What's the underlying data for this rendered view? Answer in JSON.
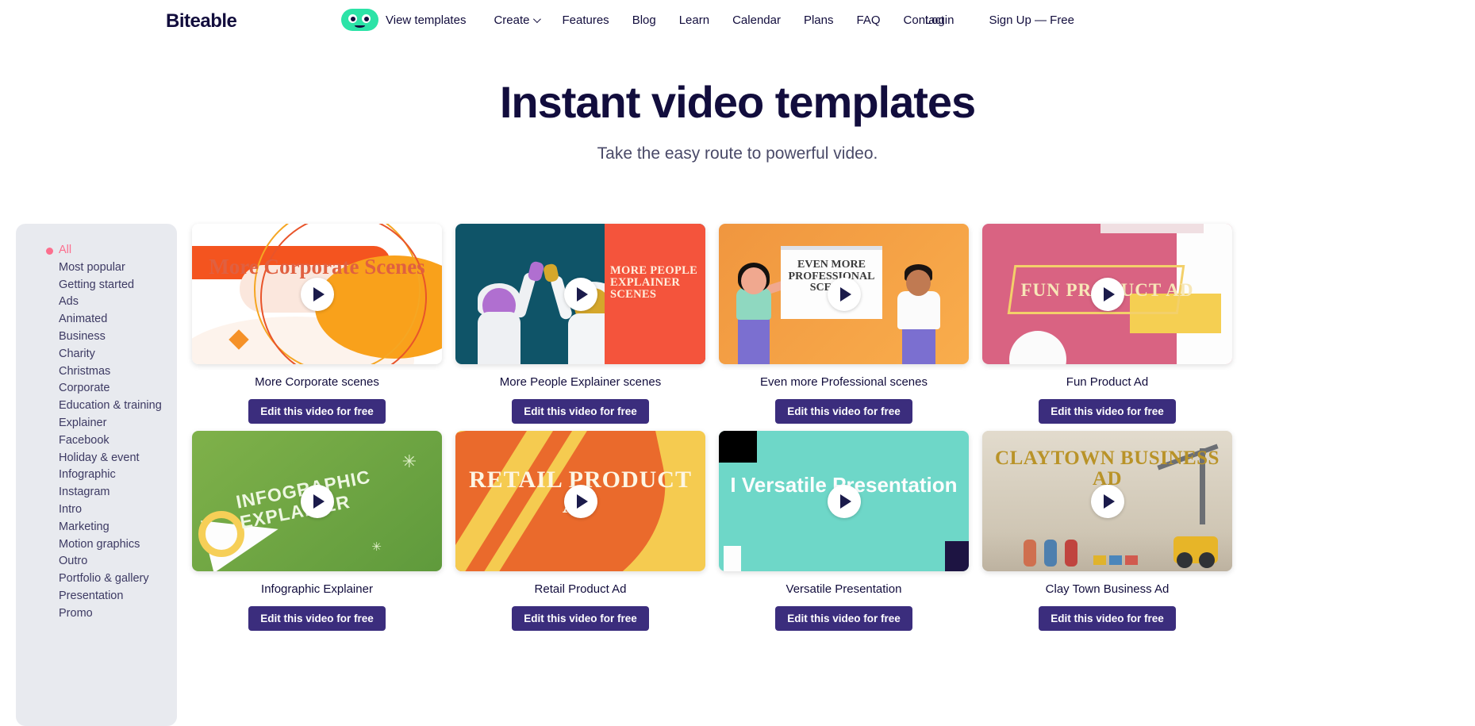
{
  "header": {
    "logo": "Biteable",
    "view_templates": "View templates",
    "nav": [
      {
        "label": "Create",
        "has_chevron": true
      },
      {
        "label": "Features",
        "has_chevron": false
      },
      {
        "label": "Blog",
        "has_chevron": false
      },
      {
        "label": "Learn",
        "has_chevron": false
      },
      {
        "label": "Calendar",
        "has_chevron": false
      },
      {
        "label": "Plans",
        "has_chevron": false
      },
      {
        "label": "FAQ",
        "has_chevron": false
      },
      {
        "label": "Contact",
        "has_chevron": false
      }
    ],
    "login": "Login",
    "signup": "Sign Up — Free"
  },
  "hero": {
    "title": "Instant video templates",
    "subtitle": "Take the easy route to powerful video."
  },
  "sidebar": {
    "active": "All",
    "items": [
      {
        "label": "All"
      },
      {
        "label": "Most popular"
      },
      {
        "label": "Getting started"
      },
      {
        "label": "Ads"
      },
      {
        "label": "Animated"
      },
      {
        "label": "Business"
      },
      {
        "label": "Charity"
      },
      {
        "label": "Christmas"
      },
      {
        "label": "Corporate"
      },
      {
        "label": "Education & training"
      },
      {
        "label": "Explainer"
      },
      {
        "label": "Facebook"
      },
      {
        "label": "Holiday & event"
      },
      {
        "label": "Infographic"
      },
      {
        "label": "Instagram"
      },
      {
        "label": "Intro"
      },
      {
        "label": "Marketing"
      },
      {
        "label": "Motion graphics"
      },
      {
        "label": "Outro"
      },
      {
        "label": "Portfolio & gallery"
      },
      {
        "label": "Presentation"
      },
      {
        "label": "Promo"
      }
    ]
  },
  "colors": {
    "brand_dark": "#120d3d",
    "accent_pink": "#fc6f8e",
    "mascot_green": "#2ce3a7",
    "button_purple": "#3b2d7d",
    "sidebar_bg": "#e8eaef"
  },
  "cards": [
    {
      "title": "More Corporate scenes",
      "button": "Edit this video for free",
      "thumb_text": "More Corporate Scenes"
    },
    {
      "title": "More People Explainer scenes",
      "button": "Edit this video for free",
      "thumb_text": "MORE PEOPLE EXPLAINER SCENES"
    },
    {
      "title": "Even more Professional scenes",
      "button": "Edit this video for free",
      "thumb_text": "EVEN MORE PROFESSIONAL SCENES"
    },
    {
      "title": "Fun Product Ad",
      "button": "Edit this video for free",
      "thumb_text": "FUN PRODUCT AD"
    },
    {
      "title": "Infographic Explainer",
      "button": "Edit this video for free",
      "thumb_text": "INFOGRAPHIC EXPLAINER"
    },
    {
      "title": "Retail Product Ad",
      "button": "Edit this video for free",
      "thumb_text": "RETAIL PRODUCT AD"
    },
    {
      "title": "Versatile Presentation",
      "button": "Edit this video for free",
      "thumb_text": "I Versatile Presentation"
    },
    {
      "title": "Clay Town Business Ad",
      "button": "Edit this video for free",
      "thumb_text": "CLAYTOWN BUSINESS AD"
    }
  ]
}
